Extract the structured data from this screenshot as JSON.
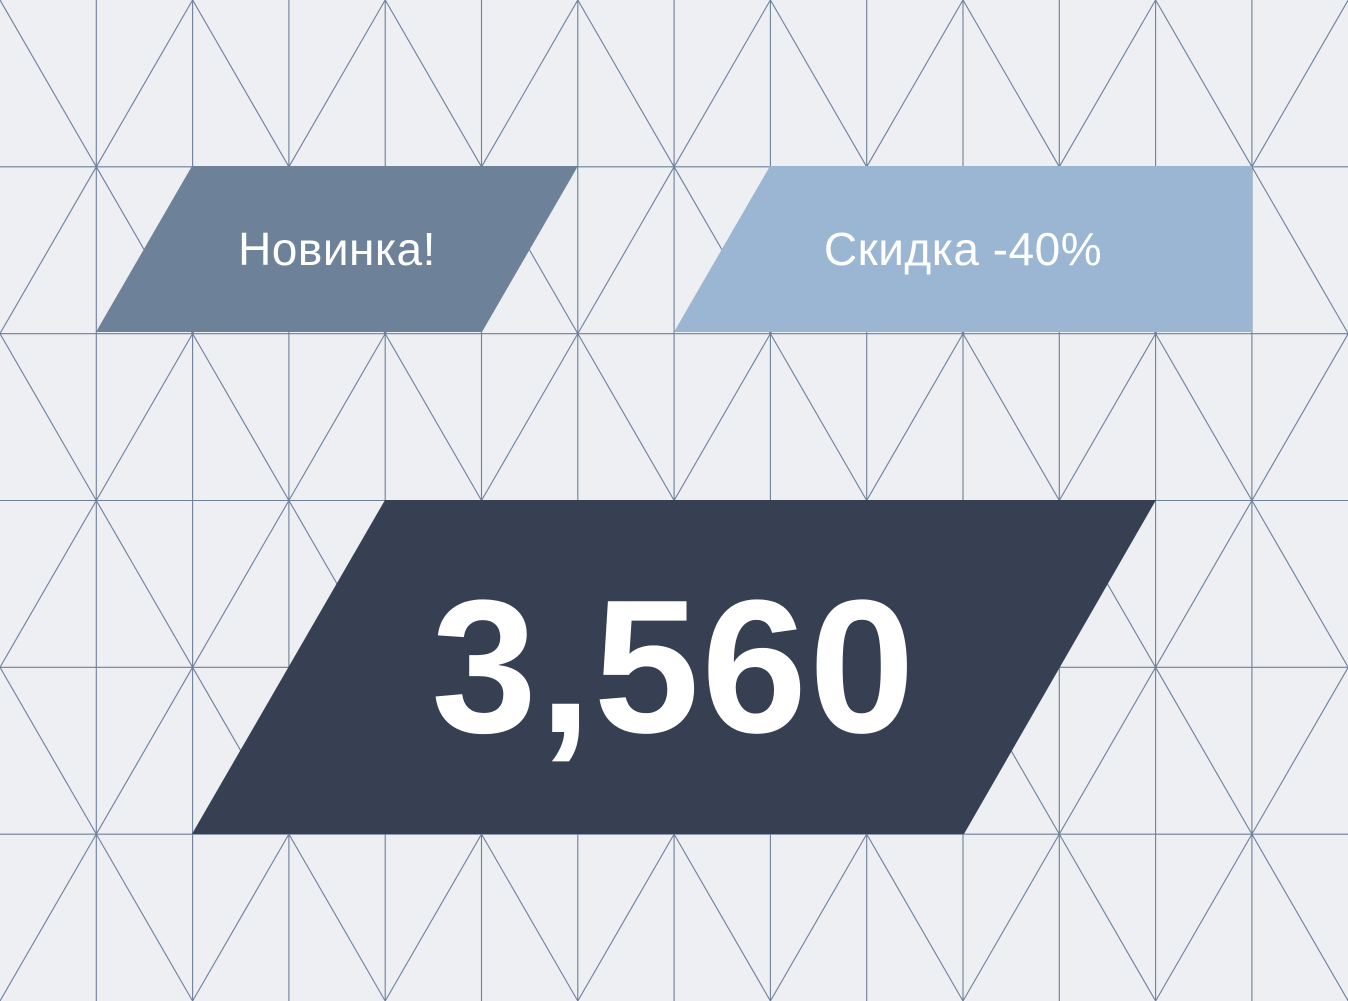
{
  "badges": {
    "new_label": "Новинка!",
    "discount_label": "Скидка -40%"
  },
  "counter": {
    "value": "3,560"
  },
  "colors": {
    "background": "#edeff3",
    "grid_line": "#6e7f9a",
    "badge_new": "#6d8199",
    "badge_discount": "#9ab6d3",
    "counter_block": "#374052",
    "text": "#ffffff"
  }
}
